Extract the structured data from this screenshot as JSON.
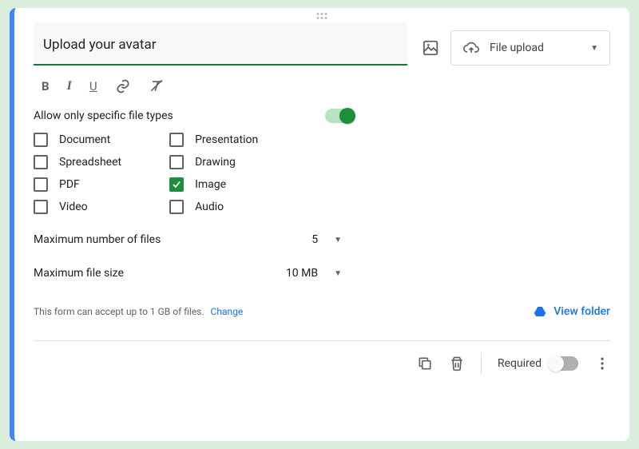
{
  "question": {
    "title": "Upload your avatar",
    "type_label": "File upload"
  },
  "toolbar": {
    "bold": "B",
    "italic": "I",
    "underline": "U"
  },
  "file_types": {
    "section_label": "Allow only specific file types",
    "enabled": true,
    "col1": [
      {
        "label": "Document",
        "checked": false
      },
      {
        "label": "Spreadsheet",
        "checked": false
      },
      {
        "label": "PDF",
        "checked": false
      },
      {
        "label": "Video",
        "checked": false
      }
    ],
    "col2": [
      {
        "label": "Presentation",
        "checked": false
      },
      {
        "label": "Drawing",
        "checked": false
      },
      {
        "label": "Image",
        "checked": true
      },
      {
        "label": "Audio",
        "checked": false
      }
    ]
  },
  "options": {
    "max_files_label": "Maximum number of files",
    "max_files_value": "5",
    "max_size_label": "Maximum file size",
    "max_size_value": "10 MB"
  },
  "info": {
    "text": "This form can accept up to 1 GB of files.",
    "change": "Change",
    "view_folder": "View folder"
  },
  "footer": {
    "required_label": "Required",
    "required": false
  }
}
